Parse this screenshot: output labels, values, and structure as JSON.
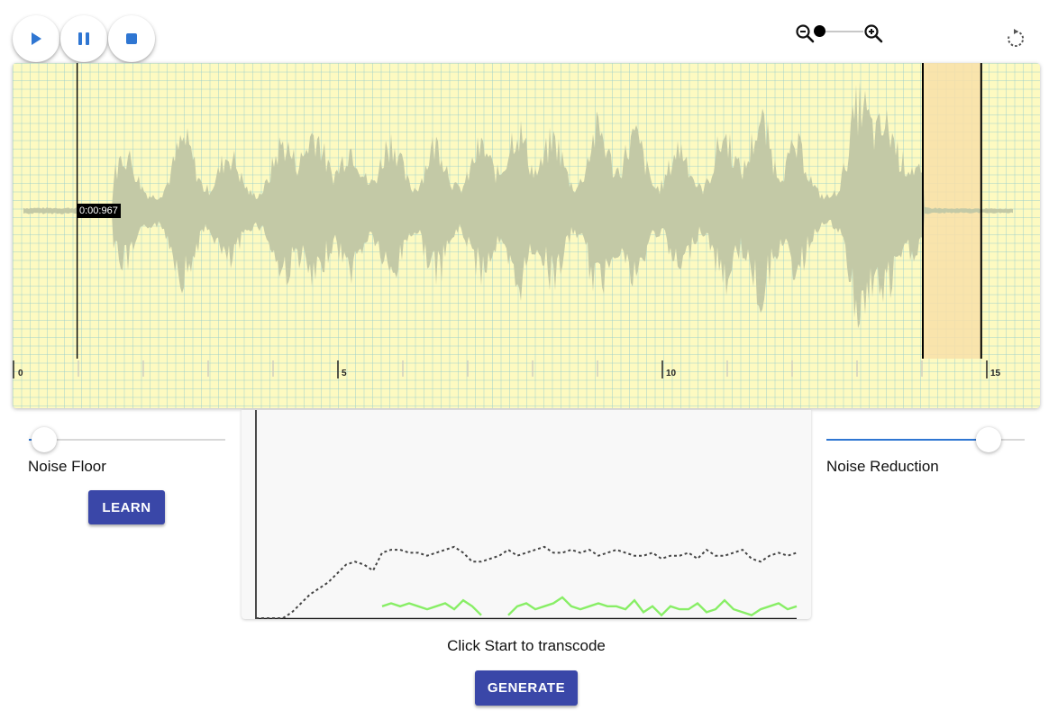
{
  "transport": {
    "play_icon": "play-icon",
    "pause_icon": "pause-icon",
    "stop_icon": "stop-icon",
    "accent": "#2f76d2"
  },
  "zoom": {
    "zoom_out_icon": "zoom-out-icon",
    "zoom_in_icon": "zoom-in-icon",
    "level": 0
  },
  "refresh_icon": "refresh-icon",
  "waveform": {
    "background": "#fdfac1",
    "wave_color": "#c3c9a6",
    "selection_color": "#f8dfa8",
    "cursor_time": "0:00:967",
    "cursor_seconds": 0.967,
    "selection_start_seconds": 14,
    "selection_end_seconds": 14.9,
    "timeline_max_seconds": 15.8,
    "ticks": [
      "0",
      "5",
      "10",
      "15"
    ]
  },
  "noise_floor": {
    "label": "Noise Floor",
    "value": 0.08,
    "learn_label": "LEARN"
  },
  "noise_reduction": {
    "label": "Noise Reduction",
    "value": 0.82
  },
  "chart_data": {
    "type": "line",
    "title": "",
    "xlabel": "",
    "ylabel": "",
    "x": [
      0,
      1,
      2,
      3,
      4,
      5,
      6,
      7,
      8,
      9,
      10,
      11,
      12,
      13,
      14,
      15,
      16,
      17,
      18,
      19,
      20,
      21,
      22,
      23,
      24,
      25,
      26,
      27,
      28,
      29,
      30,
      31,
      32,
      33,
      34,
      35,
      36,
      37,
      38,
      39,
      40,
      41,
      42,
      43,
      44,
      45,
      46,
      47,
      48,
      49,
      50,
      51,
      52,
      53,
      54,
      55,
      56,
      57,
      58,
      59,
      60
    ],
    "series": [
      {
        "color": "#444444",
        "dashed": true,
        "values": [
          0,
          0,
          0,
          0,
          2,
          5,
          8,
          10,
          12,
          15,
          18,
          19,
          18,
          16,
          22,
          23,
          23,
          22,
          22,
          21,
          22,
          23,
          24,
          22,
          19,
          19,
          20,
          21,
          23,
          21,
          22,
          23,
          24,
          22,
          22,
          23,
          22,
          23,
          21,
          22,
          23,
          22,
          21,
          21,
          22,
          20,
          21,
          21,
          22,
          20,
          23,
          21,
          21,
          22,
          23,
          20,
          19,
          21,
          22,
          21,
          22
        ],
        "name": ""
      },
      {
        "color": "#88ee66",
        "dashed": false,
        "values": [
          null,
          null,
          null,
          null,
          null,
          null,
          null,
          null,
          null,
          null,
          null,
          null,
          null,
          null,
          4,
          5,
          4,
          5,
          4,
          3,
          4,
          5,
          3,
          6,
          4,
          1,
          null,
          null,
          1,
          4,
          5,
          3,
          4,
          5,
          7,
          4,
          3,
          4,
          5,
          4,
          4,
          3,
          6,
          2,
          4,
          1,
          4,
          3,
          3,
          5,
          2,
          3,
          6,
          3,
          2,
          1,
          3,
          4,
          5,
          3,
          4
        ],
        "name": ""
      }
    ],
    "ylim": [
      0,
      70
    ]
  },
  "status_text": "Click Start to transcode",
  "generate_label": "GENERATE"
}
